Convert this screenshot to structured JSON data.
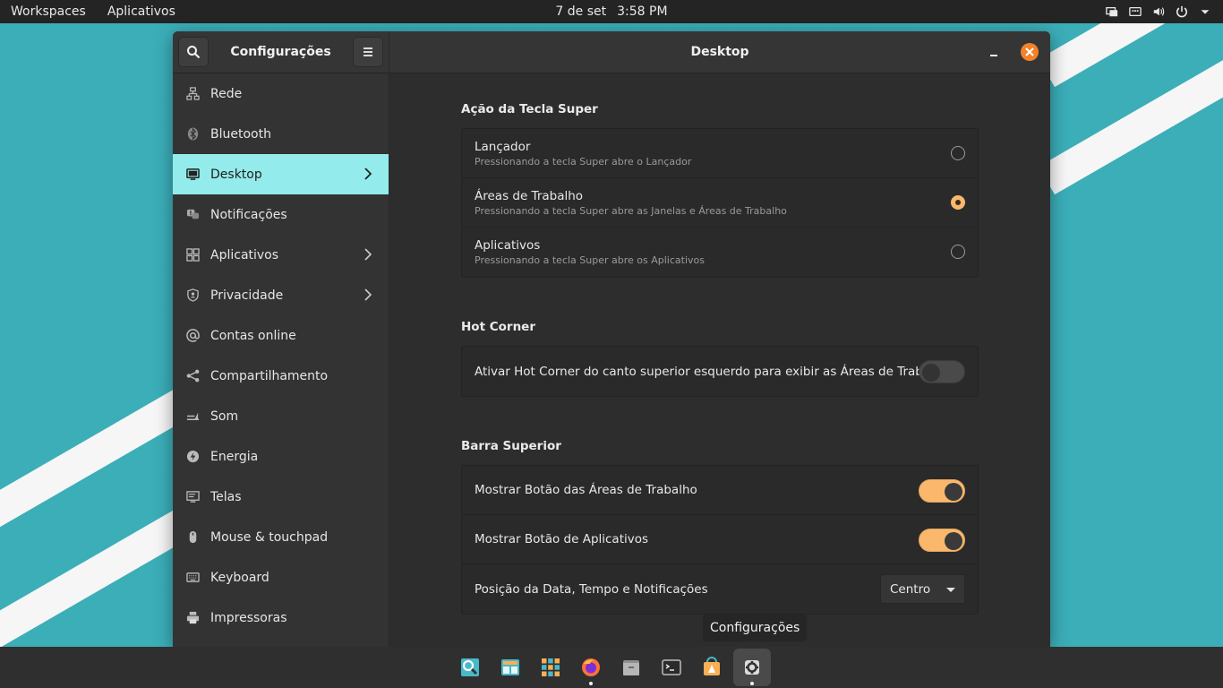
{
  "top_panel": {
    "workspaces_label": "Workspaces",
    "apps_label": "Aplicativos",
    "date": "7 de set",
    "time": "3:58 PM"
  },
  "window": {
    "sidebar_title": "Configurações",
    "main_title": "Desktop"
  },
  "sidebar": {
    "items": [
      {
        "label": "Rede",
        "icon": "network-icon"
      },
      {
        "label": "Bluetooth",
        "icon": "bluetooth-icon"
      },
      {
        "label": "Desktop",
        "icon": "desktop-icon"
      },
      {
        "label": "Notificações",
        "icon": "notifications-icon"
      },
      {
        "label": "Aplicativos",
        "icon": "apps-grid-icon"
      },
      {
        "label": "Privacidade",
        "icon": "privacy-icon"
      },
      {
        "label": "Contas online",
        "icon": "at-icon"
      },
      {
        "label": "Compartilhamento",
        "icon": "share-icon"
      },
      {
        "label": "Som",
        "icon": "sound-icon"
      },
      {
        "label": "Energia",
        "icon": "power-icon"
      },
      {
        "label": "Telas",
        "icon": "display-icon"
      },
      {
        "label": "Mouse & touchpad",
        "icon": "mouse-icon"
      },
      {
        "label": "Keyboard",
        "icon": "keyboard-icon"
      },
      {
        "label": "Impressoras",
        "icon": "printer-icon"
      }
    ]
  },
  "super_key": {
    "title": "Ação da Tecla Super",
    "options": [
      {
        "title": "Lançador",
        "subtitle": "Pressionando a tecla Super abre o Lançador",
        "checked": false
      },
      {
        "title": "Áreas de Trabalho",
        "subtitle": "Pressionando a tecla Super abre as Janelas e Áreas de Trabalho",
        "checked": true
      },
      {
        "title": "Aplicativos",
        "subtitle": "Pressionando a tecla Super abre os Aplicativos",
        "checked": false
      }
    ]
  },
  "hot_corner": {
    "title": "Hot Corner",
    "label": "Ativar Hot Corner do canto superior esquerdo para exibir as Áreas de Trabalho",
    "enabled": false
  },
  "top_bar": {
    "title": "Barra Superior",
    "workspaces_button_label": "Mostrar Botão das Áreas de Trabalho",
    "workspaces_button_enabled": true,
    "apps_button_label": "Mostrar Botão de Aplicativos",
    "apps_button_enabled": true,
    "position_label": "Posição da Data, Tempo e Notificações",
    "position_value": "Centro"
  },
  "tooltip": "Configurações",
  "colors": {
    "accent": "#fbb86c",
    "active_nav": "#94ebeb",
    "close": "#f3822a",
    "wallpaper": "#3cb1bc"
  }
}
